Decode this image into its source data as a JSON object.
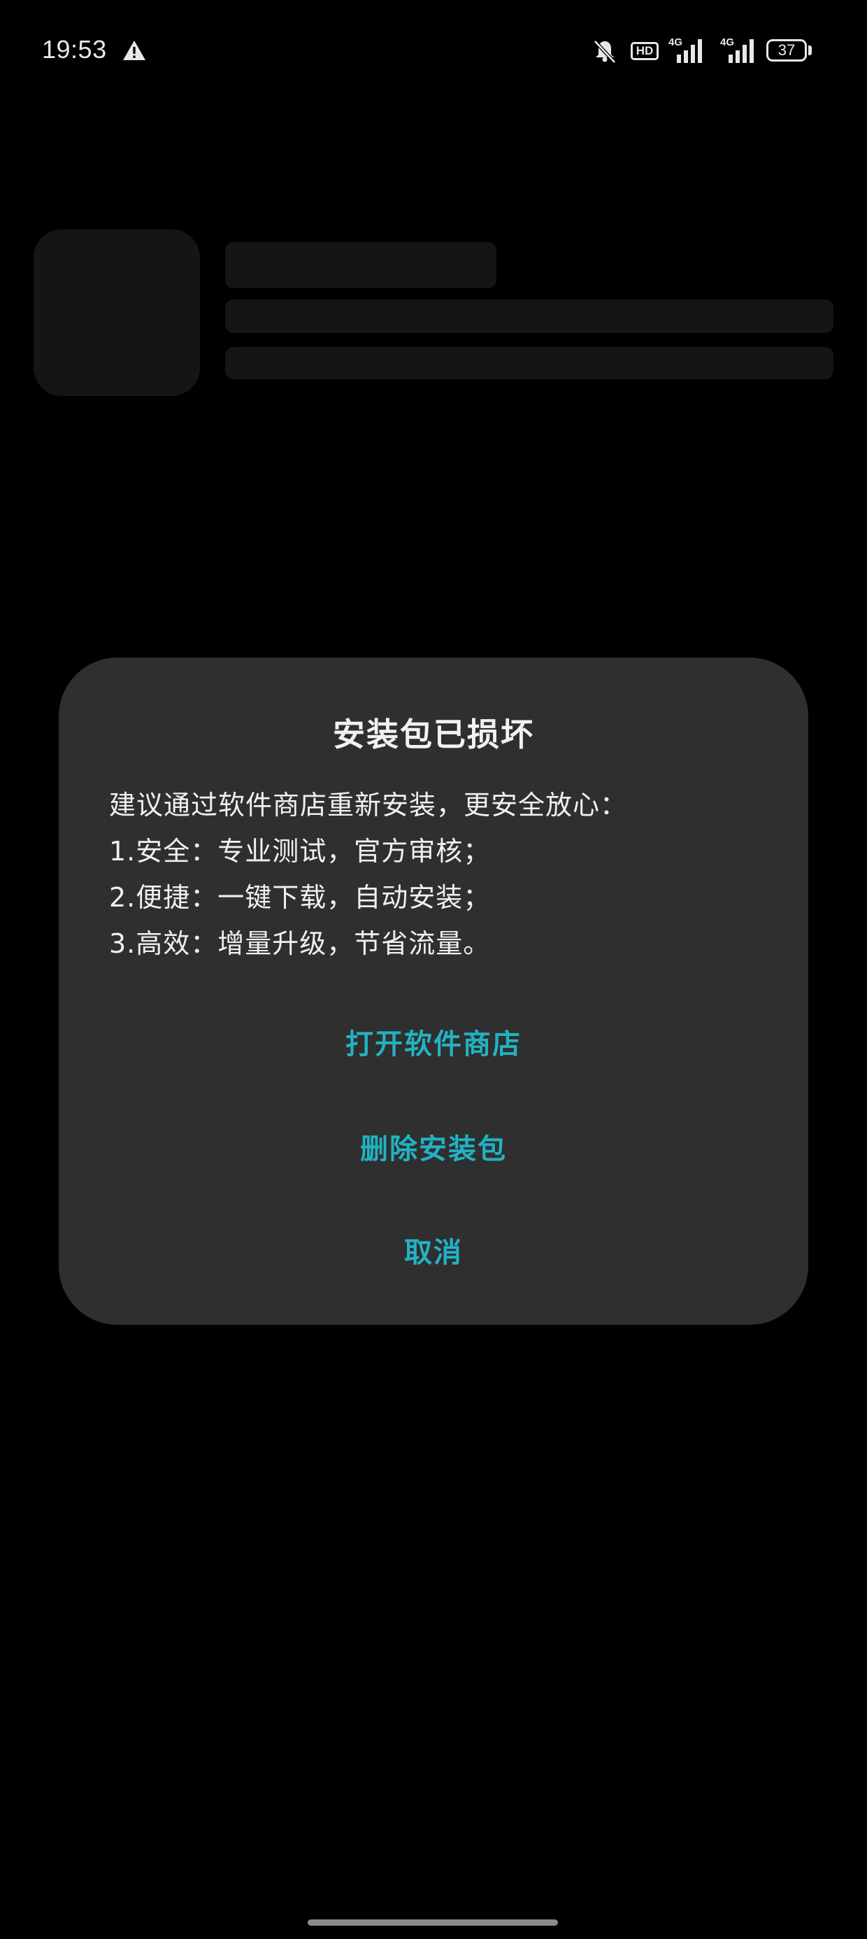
{
  "status_bar": {
    "time": "19:53",
    "hd_label": "HD",
    "network_1": "4G",
    "network_2": "4G",
    "battery": "37",
    "icons": [
      "warning-icon",
      "mute-bell-icon",
      "hd-icon",
      "signal-4g-icon",
      "signal-4g-icon",
      "battery-icon"
    ]
  },
  "dialog": {
    "title": "安装包已损坏",
    "body": [
      "建议通过软件商店重新安装，更安全放心：",
      "1.安全：专业测试，官方审核；",
      "2.便捷：一键下载，自动安装；",
      "3.高效：增量升级，节省流量。"
    ],
    "actions": {
      "open_store": "打开软件商店",
      "delete_package": "删除安装包",
      "cancel": "取消"
    }
  },
  "colors": {
    "background": "#000000",
    "dialog_bg": "#2f2f2f",
    "accent": "#22b2c3",
    "skeleton": "#151515"
  }
}
